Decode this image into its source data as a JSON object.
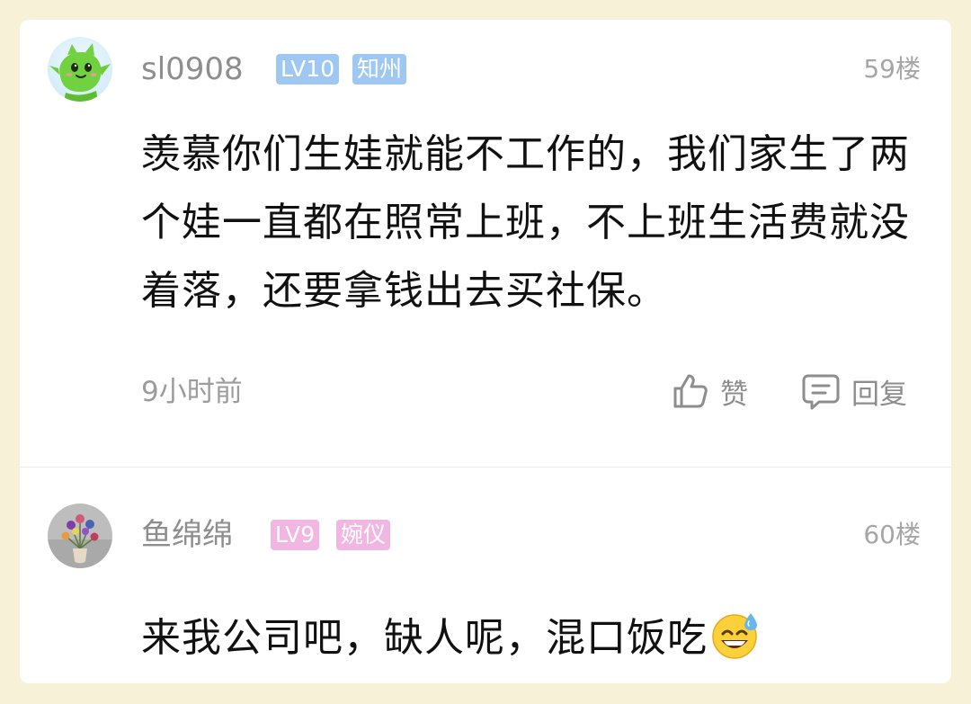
{
  "comments": [
    {
      "username": "sl0908",
      "level": "LV10",
      "tag": "知州",
      "floor": "59楼",
      "content": "羡慕你们生娃就能不工作的，我们家生了两个娃一直都在照常上班，不上班生活费就没着落，还要拿钱出去买社保。",
      "time": "9小时前",
      "like_label": "赞",
      "reply_label": "回复",
      "badge_color": "#9ec8f1"
    },
    {
      "username": "鱼绵绵",
      "level": "LV9",
      "tag": "婉仪",
      "floor": "60楼",
      "content": "来我公司吧，缺人呢，混口饭吃",
      "emoji": "sweat-smile-emoji",
      "badge_color": "#f2b6e3"
    }
  ],
  "colors": {
    "background": "#f7f1d7",
    "card": "#ffffff",
    "username": "#8e8e8e",
    "content": "#111111",
    "meta": "#9c9c9c"
  }
}
